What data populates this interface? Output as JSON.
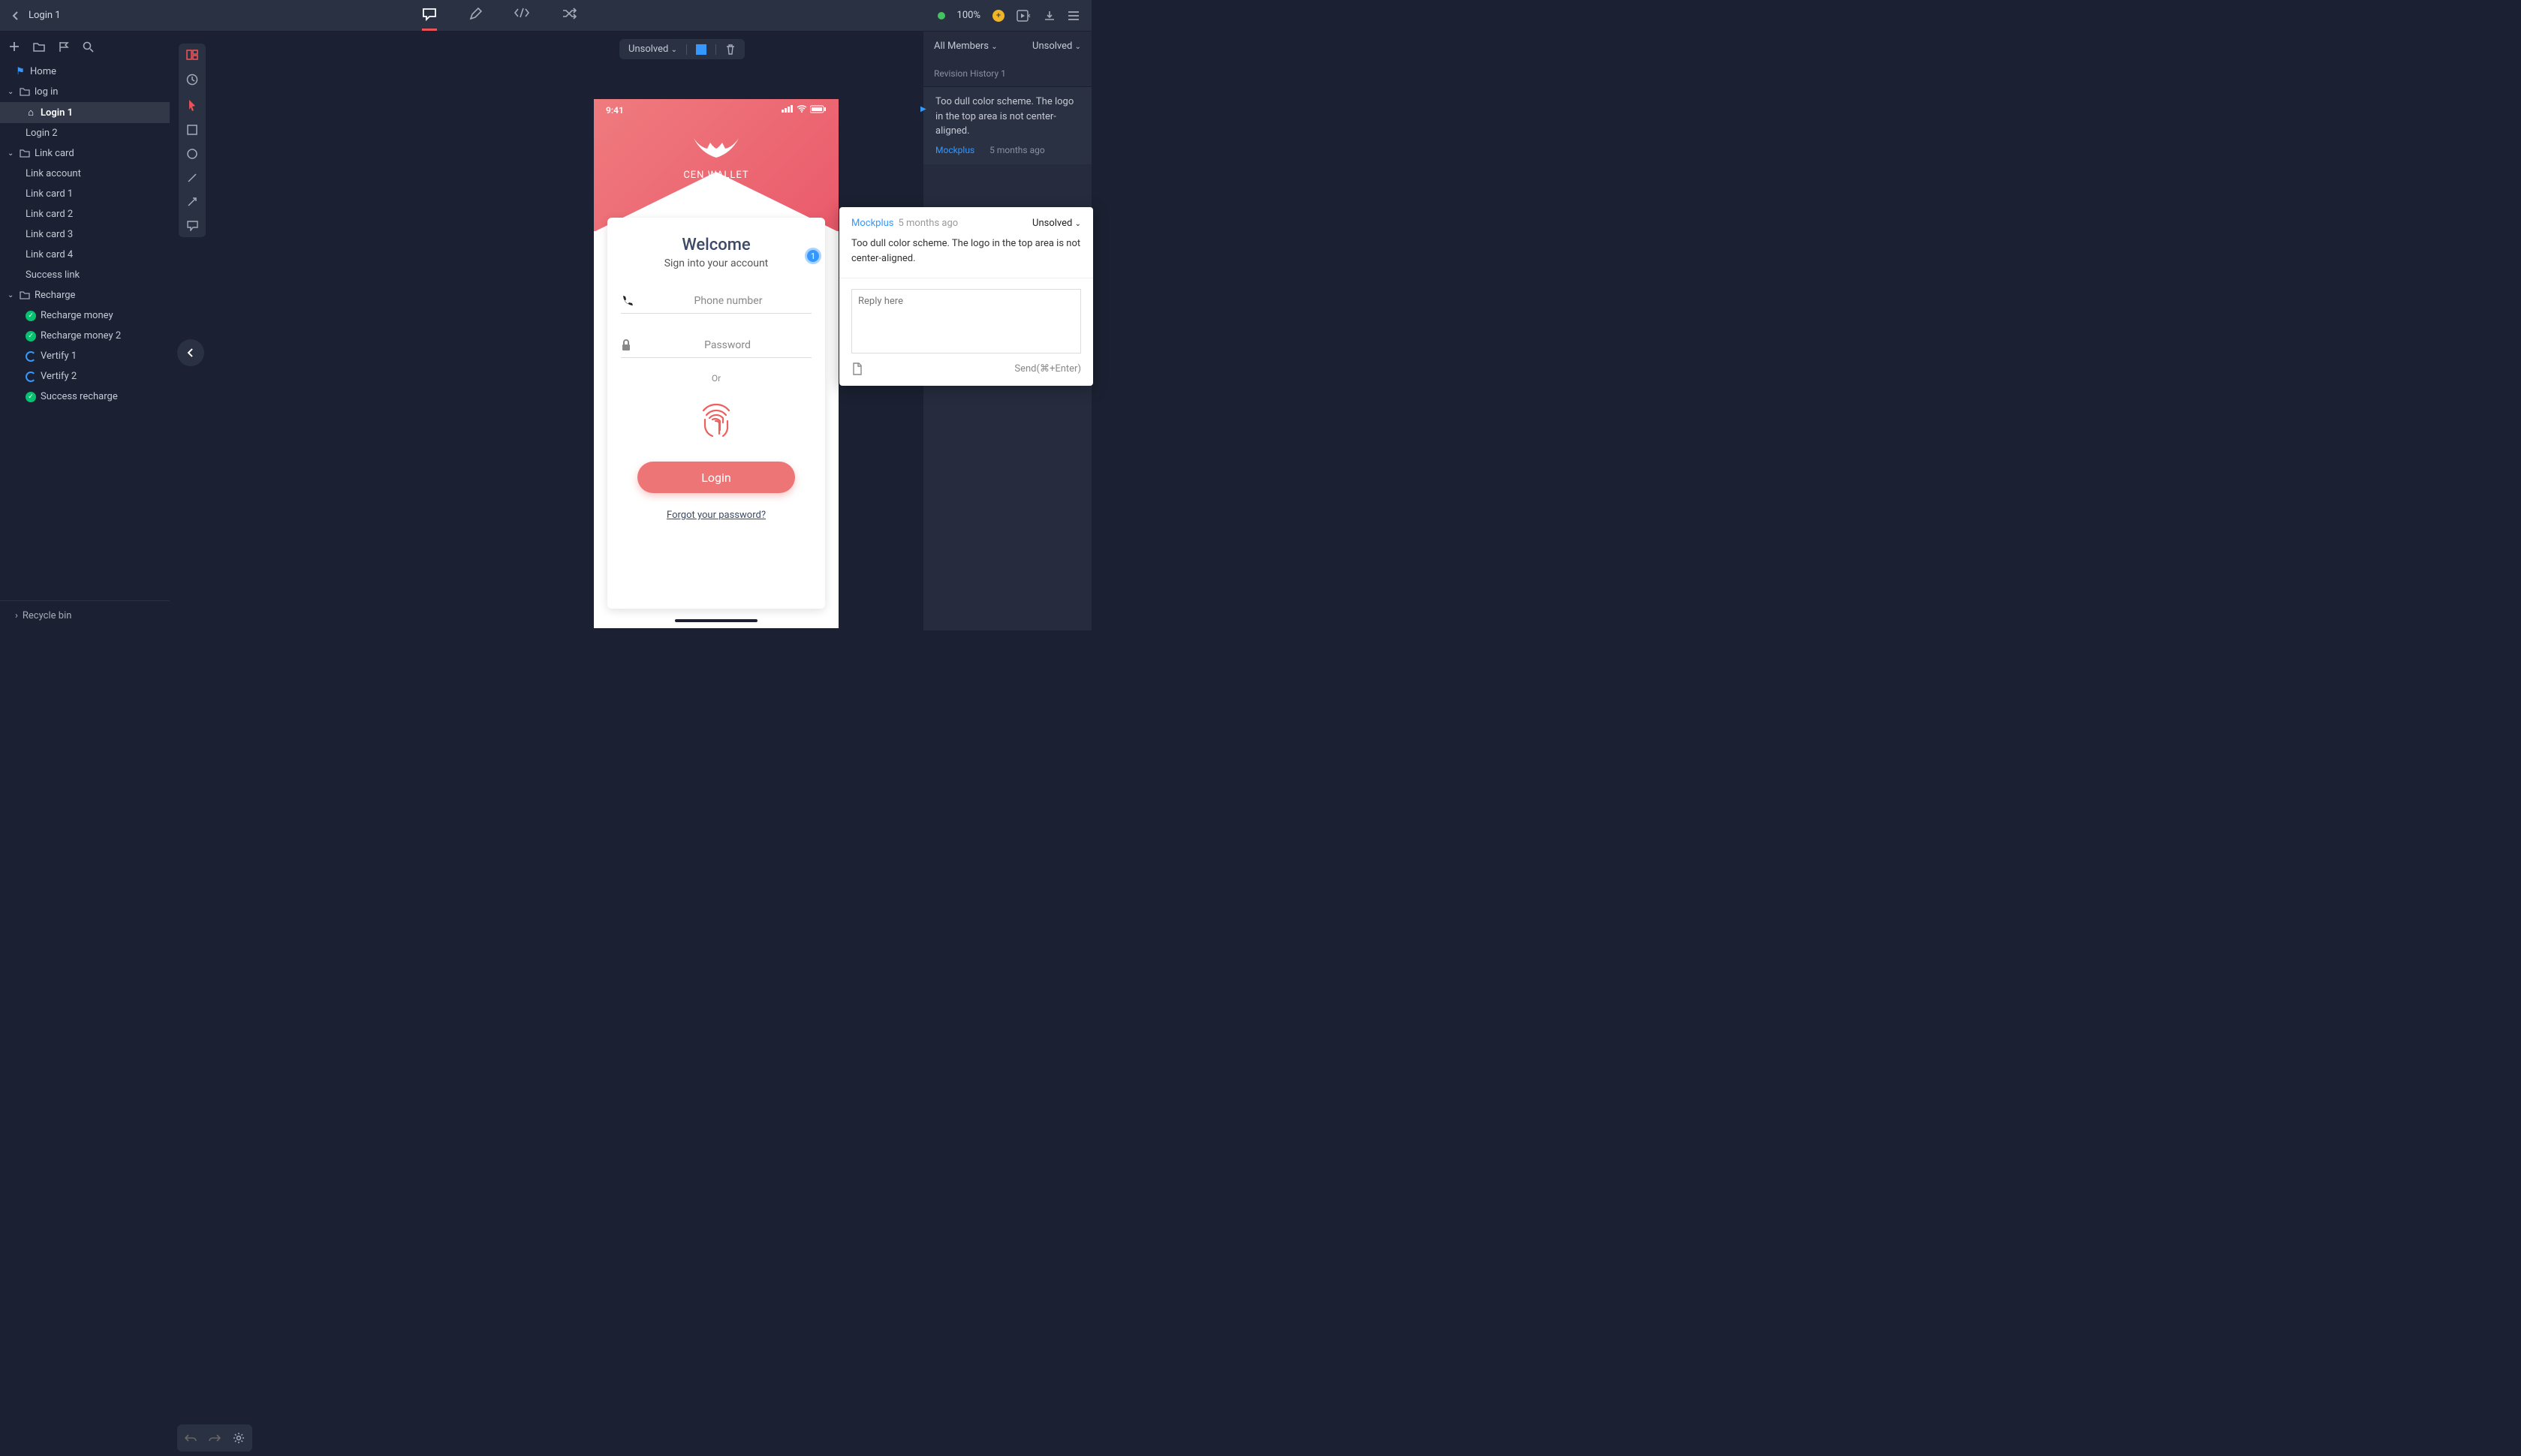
{
  "topbar": {
    "page_name": "Login 1",
    "zoom": "100%"
  },
  "sidebar": {
    "home": "Home",
    "login_folder": "log in",
    "login1": "Login 1",
    "login2": "Login 2",
    "linkcard_folder": "Link card",
    "link_account": "Link account",
    "link_card_1": "Link card 1",
    "link_card_2": "Link card 2",
    "link_card_3": "Link card 3",
    "link_card_4": "Link card 4",
    "success_link": "Success link",
    "recharge_folder": "Recharge",
    "recharge_money": "Recharge money",
    "recharge_money_2": "Recharge money 2",
    "vertify_1": "Vertify 1",
    "vertify_2": "Vertify 2",
    "success_recharge": "Success recharge",
    "recycle": "Recycle bin"
  },
  "filter": {
    "status": "Unsolved"
  },
  "phone": {
    "time": "9:41",
    "brand": "CEN WALLET",
    "welcome": "Welcome",
    "subtitle": "Sign into your account",
    "phone_ph": "Phone number",
    "password_ph": "Password",
    "or": "Or",
    "login": "Login",
    "forgot": "Forgot your password?",
    "marker_num": "1"
  },
  "popup": {
    "author": "Mockplus",
    "time": "5 months ago",
    "status": "Unsolved",
    "body": "Too dull color scheme. The logo in the top area is not center-aligned.",
    "reply_ph": "Reply here",
    "send": "Send(⌘+Enter)"
  },
  "rightpanel": {
    "members": "All Members",
    "status": "Unsolved",
    "revision": "Revision History 1",
    "item_body": "Too dull color scheme. The logo in the top area is not center-aligned.",
    "item_author": "Mockplus",
    "item_time": "5 months ago"
  }
}
